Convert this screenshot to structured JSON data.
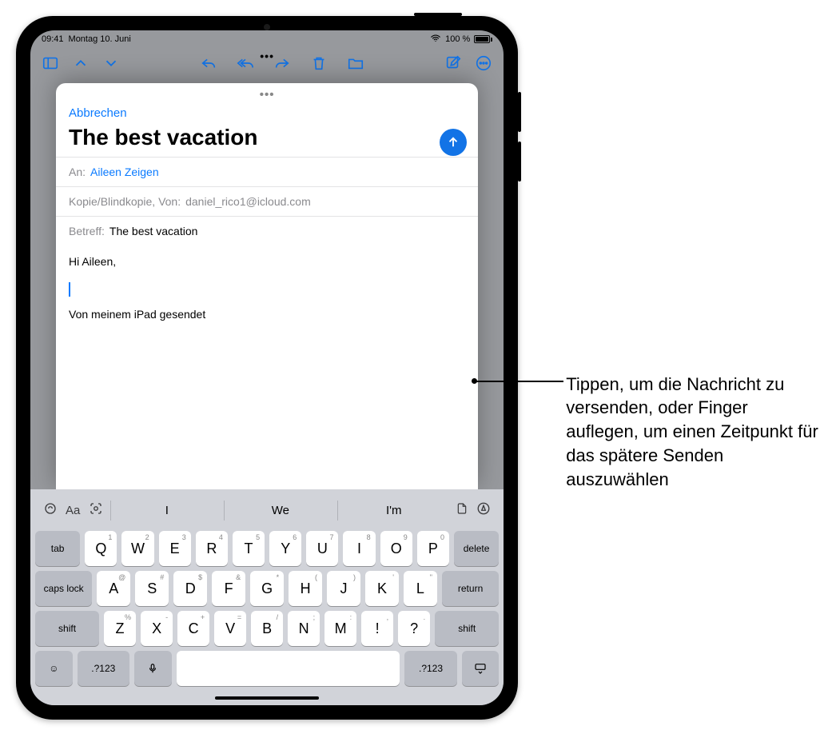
{
  "status": {
    "time": "09:41",
    "date": "Montag 10. Juni",
    "battery_pct": "100 %"
  },
  "compose": {
    "cancel": "Abbrechen",
    "subject_title": "The best vacation",
    "to_label": "An:",
    "to_value": "Aileen Zeigen",
    "cc_label": "Kopie/Blindkopie, Von:",
    "cc_value": "daniel_rico1@icloud.com",
    "subject_label": "Betreff:",
    "subject_value": "The best vacation",
    "body_greeting": "Hi Aileen,",
    "signature": "Von meinem iPad gesendet"
  },
  "suggestions": [
    "I",
    "We",
    "I'm"
  ],
  "keys": {
    "row1": [
      {
        "k": "Q",
        "s": "1"
      },
      {
        "k": "W",
        "s": "2"
      },
      {
        "k": "E",
        "s": "3"
      },
      {
        "k": "R",
        "s": "4"
      },
      {
        "k": "T",
        "s": "5"
      },
      {
        "k": "Y",
        "s": "6"
      },
      {
        "k": "U",
        "s": "7"
      },
      {
        "k": "I",
        "s": "8"
      },
      {
        "k": "O",
        "s": "9"
      },
      {
        "k": "P",
        "s": "0"
      }
    ],
    "row2": [
      {
        "k": "A",
        "s": "@"
      },
      {
        "k": "S",
        "s": "#"
      },
      {
        "k": "D",
        "s": "$"
      },
      {
        "k": "F",
        "s": "&"
      },
      {
        "k": "G",
        "s": "*"
      },
      {
        "k": "H",
        "s": "("
      },
      {
        "k": "J",
        "s": ")"
      },
      {
        "k": "K",
        "s": "'"
      },
      {
        "k": "L",
        "s": "\""
      }
    ],
    "row3": [
      {
        "k": "Z",
        "s": "%"
      },
      {
        "k": "X",
        "s": "-"
      },
      {
        "k": "C",
        "s": "+"
      },
      {
        "k": "V",
        "s": "="
      },
      {
        "k": "B",
        "s": "/"
      },
      {
        "k": "N",
        "s": ";"
      },
      {
        "k": "M",
        "s": ":"
      },
      {
        "k": "!",
        "s": ","
      },
      {
        "k": "?",
        "s": "."
      }
    ],
    "tab": "tab",
    "delete": "delete",
    "caps": "caps lock",
    "return": "return",
    "shift": "shift",
    "numsym": ".?123"
  },
  "callout_text": "Tippen, um die Nachricht zu versenden, oder Finger auflegen, um einen Zeitpunkt für das spätere Senden auszuwählen"
}
